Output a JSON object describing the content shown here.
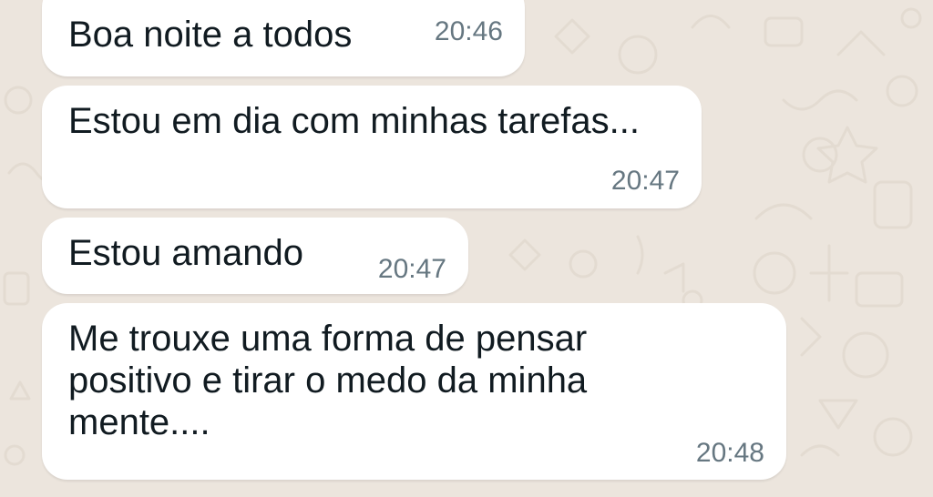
{
  "chat": {
    "background_color": "#ece5dd",
    "bubble_color": "#ffffff",
    "text_color": "#111b21",
    "time_color": "#667781",
    "messages": [
      {
        "text": "Boa noite a todos",
        "time": "20:46"
      },
      {
        "text": "Estou em dia com minhas tarefas...",
        "time": "20:47"
      },
      {
        "text": "Estou amando",
        "time": "20:47"
      },
      {
        "text": "Me trouxe uma forma de pensar\npositivo e tirar o medo da minha\nmente....",
        "time": "20:48"
      }
    ]
  }
}
